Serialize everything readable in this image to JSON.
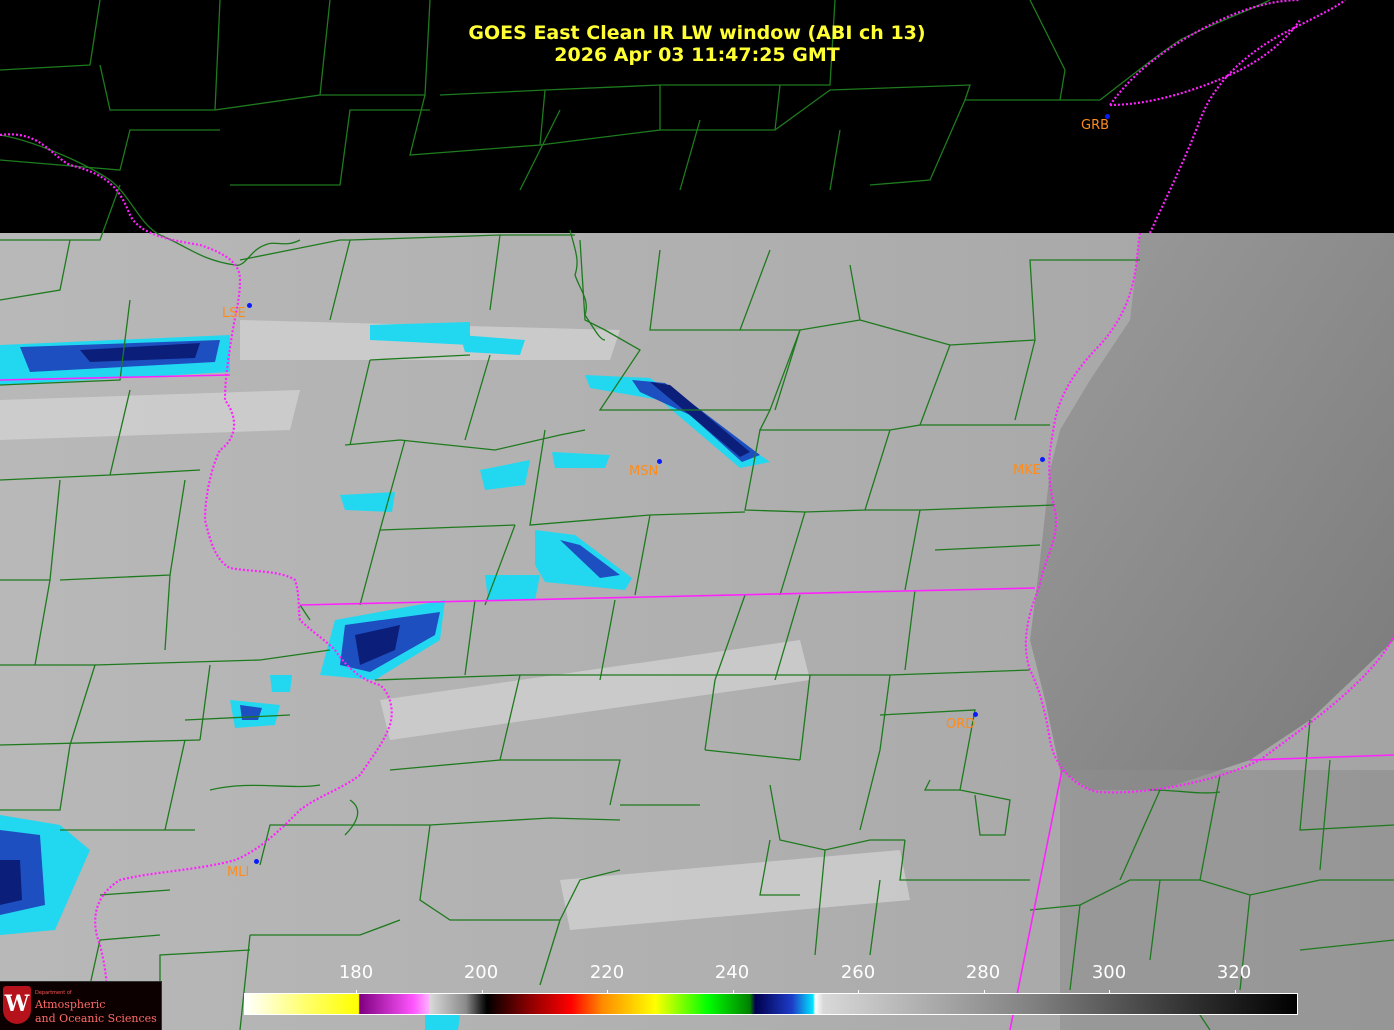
{
  "title": {
    "line1": "GOES East Clean IR LW window (ABI ch 13)",
    "line2": "2026 Apr 03  11:47:25 GMT"
  },
  "stations": [
    {
      "id": "grb",
      "label": "GRB"
    },
    {
      "id": "lse",
      "label": "LSE"
    },
    {
      "id": "msn",
      "label": "MSN"
    },
    {
      "id": "mke",
      "label": "MKE"
    },
    {
      "id": "ord",
      "label": "ORD"
    },
    {
      "id": "mli",
      "label": "MLI"
    }
  ],
  "colorbar": {
    "ticks": [
      "180",
      "200",
      "220",
      "240",
      "260",
      "280",
      "300",
      "320"
    ],
    "min": 163,
    "max": 330
  },
  "logo": {
    "seal": "W",
    "dept": "Department of",
    "line1": "Atmospheric",
    "line2": "and Oceanic Sciences"
  },
  "colors": {
    "title": "#ffff33",
    "station_label": "#ff8c1a",
    "county_lines": "#1e7a1e",
    "state_lines": "#ff22ff",
    "station_dot": "#0a1aff"
  }
}
